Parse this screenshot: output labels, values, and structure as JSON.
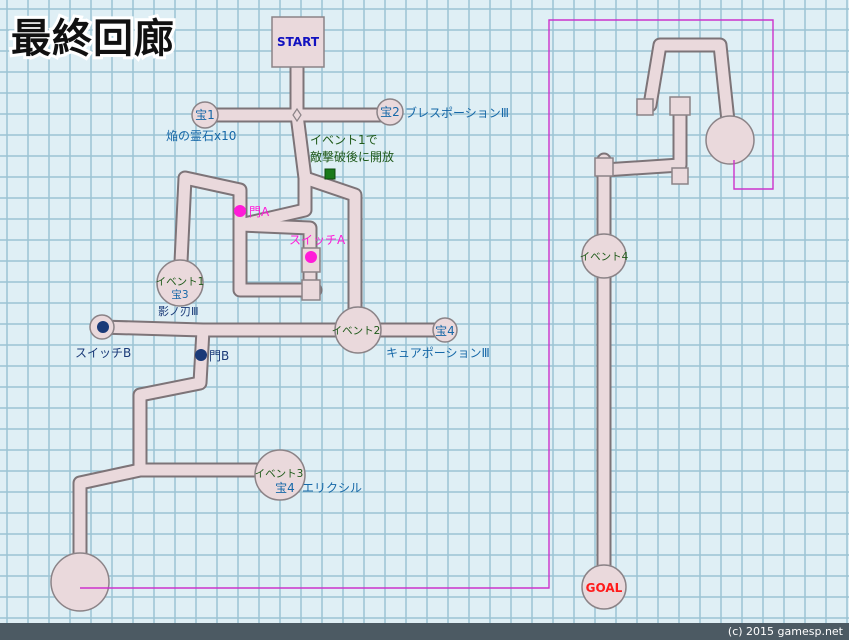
{
  "title": "最終回廊",
  "credit": "(c) 2015 gamesp.net",
  "colors": {
    "background": "#dfeff5",
    "grid": "#9cc4d3",
    "corridor_fill": "#ead9dc",
    "corridor_edge": "#7d7478",
    "teal_text": "#1668a8",
    "green_text": "#1f5a1a",
    "magenta": "#ff1bd8",
    "navy": "#1a3a78",
    "start_text": "#1111c0",
    "goal_text": "#ff1a1a",
    "footer": "#4c5a63"
  },
  "labels": {
    "start": "START",
    "goal": "GOAL",
    "treasure1": "宝1",
    "treasure1_item": "焔の霊石x10",
    "treasure2": "宝2",
    "treasure2_item": "ブレスポーションⅢ",
    "event1_note_line1": "イベント1で",
    "event1_note_line2": "敵撃破後に開放",
    "gate_a": "門A",
    "switch_a": "スイッチA",
    "event1": "イベント1",
    "treasure3": "宝3",
    "treasure3_item": "影ノ刃Ⅲ",
    "switch_b": "スイッチB",
    "gate_b": "門B",
    "event2": "イベント2",
    "treasure4_east": "宝4",
    "treasure4_east_item": "キュアポーションⅢ",
    "event3": "イベント3",
    "treasure4_south": "宝4",
    "treasure4_south_item": "エリクシル",
    "event4": "イベント4"
  }
}
